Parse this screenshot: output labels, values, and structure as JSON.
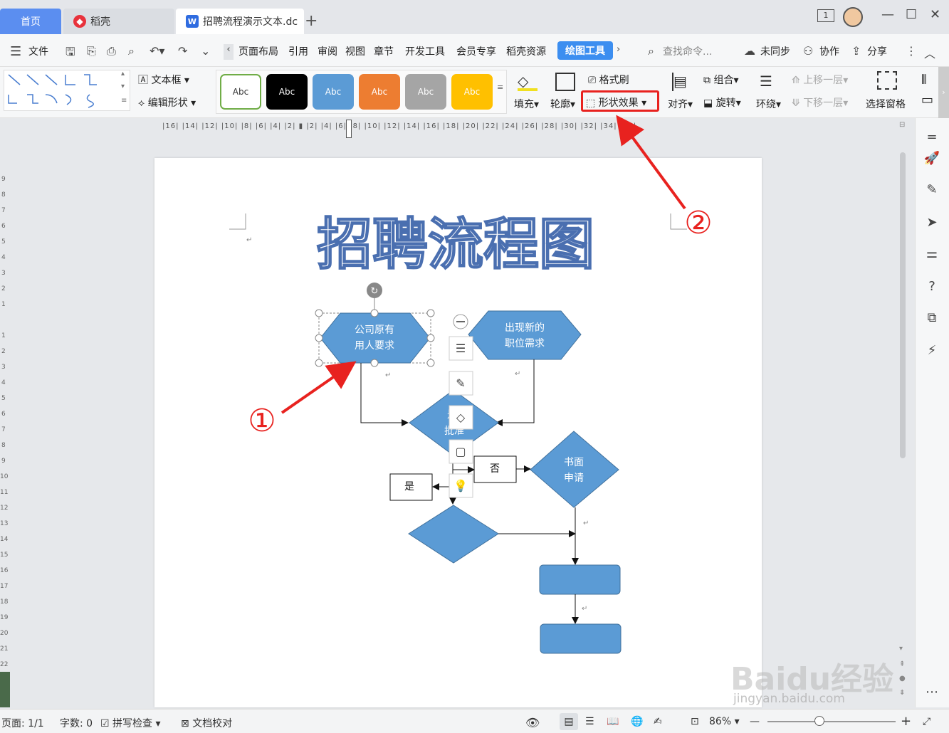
{
  "tabs": {
    "home": "首页",
    "daoke": "稻壳",
    "doc": "招聘流程演示文本.dc",
    "window_badge": "1"
  },
  "menu": {
    "file": "文件",
    "items": [
      "页面布局",
      "引用",
      "审阅",
      "视图",
      "章节",
      "开发工具",
      "会员专享",
      "稻壳资源"
    ],
    "active": "绘图工具",
    "search_placeholder": "查找命令...",
    "unsynced": "未同步",
    "collab": "协作",
    "share": "分享"
  },
  "ribbon": {
    "textbox": "文本框",
    "edit_shape": "编辑形状",
    "style_samples": [
      "Abc",
      "Abc",
      "Abc",
      "Abc",
      "Abc",
      "Abc"
    ],
    "style_colors": [
      "#ffffff",
      "#000000",
      "#5b9bd5",
      "#ed7d31",
      "#a5a5a5",
      "#ffc000"
    ],
    "fill": "填充",
    "outline": "轮廓",
    "format_painter": "格式刷",
    "shape_effect": "形状效果",
    "align": "对齐",
    "group": "组合",
    "rotate": "旋转",
    "wrap": "环绕",
    "bring_forward": "上移一层",
    "send_backward": "下移一层",
    "selection_pane": "选择窗格"
  },
  "ruler": {
    "ticks": "|16| |14| |12| |10| |8| |6| |4| |2| ▮ |2| |4| |6| |8| |10| |12| |14| |16| |18| |20| |22| |24| |26| |28| |30| |32| |34| |36|"
  },
  "document": {
    "title_art": "招聘流程图",
    "shape1": [
      "公司原有",
      "用人要求"
    ],
    "shape2": [
      "出现新的",
      "职位需求"
    ],
    "shape3": [
      "是否",
      "批准"
    ],
    "no_label": "否",
    "yes_label": "是",
    "written_app": [
      "书面",
      "申请"
    ],
    "annotation1": "①",
    "annotation2": "②"
  },
  "status": {
    "page": "页面: 1/1",
    "words": "字数: 0",
    "spell": "拼写检查",
    "proof": "文档校对",
    "zoom": "86%"
  },
  "watermark": {
    "brand": "Baidu经验",
    "url": "jingyan.baidu.com"
  },
  "colors": {
    "accent": "#3c8ef0",
    "shape_blue": "#5b9bd5",
    "annotation_red": "#e8221f"
  }
}
